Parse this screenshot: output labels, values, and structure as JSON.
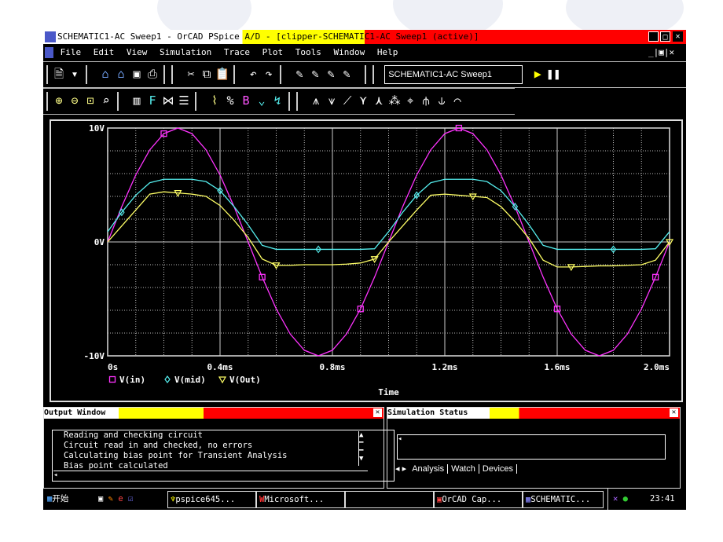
{
  "window": {
    "title_parts": [
      "SCHEMATIC1-AC Sweep1 - ",
      "OrCAD PSpice A/D",
      "  - [clipper-SCHEMAT",
      "IC1-AC Sweep1 (active)]"
    ]
  },
  "menu": [
    "File",
    "Edit",
    "View",
    "Simulation",
    "Trace",
    "Plot",
    "Tools",
    "Window",
    "Help"
  ],
  "toolbar": {
    "profile_select": "SCHEMATIC1-AC Sweep1",
    "run_icon": "play-icon",
    "pause_icon": "pause-icon"
  },
  "chart_data": {
    "type": "line",
    "xlabel": "Time",
    "x_unit": "ms",
    "xlim": [
      0,
      2.0
    ],
    "ylim": [
      -10,
      10
    ],
    "x_ticks": [
      "0s",
      "0.4ms",
      "0.8ms",
      "1.2ms",
      "1.6ms",
      "2.0ms"
    ],
    "y_ticks": [
      "10V",
      "0V",
      "-10V"
    ],
    "grid": true,
    "legend": "bottom-left",
    "x": [
      0,
      0.05,
      0.1,
      0.15,
      0.2,
      0.25,
      0.3,
      0.35,
      0.4,
      0.45,
      0.5,
      0.55,
      0.6,
      0.65,
      0.7,
      0.75,
      0.8,
      0.85,
      0.9,
      0.95,
      1.0,
      1.05,
      1.1,
      1.15,
      1.2,
      1.25,
      1.3,
      1.35,
      1.4,
      1.45,
      1.5,
      1.55,
      1.6,
      1.65,
      1.7,
      1.75,
      1.8,
      1.85,
      1.9,
      1.95,
      2.0
    ],
    "series": [
      {
        "name": "V(in)",
        "color": "#ff33ff",
        "marker": "square",
        "values": [
          0,
          3.09,
          5.88,
          8.09,
          9.51,
          10,
          9.51,
          8.09,
          5.88,
          3.09,
          0,
          -3.09,
          -5.88,
          -8.09,
          -9.51,
          -10,
          -9.51,
          -8.09,
          -5.88,
          -3.09,
          0,
          3.09,
          5.88,
          8.09,
          9.51,
          10,
          9.51,
          8.09,
          5.88,
          3.09,
          0,
          -3.09,
          -5.88,
          -8.09,
          -9.51,
          -10,
          -9.51,
          -8.09,
          -5.88,
          -3.09,
          0
        ]
      },
      {
        "name": "V(mid)",
        "color": "#55eeee",
        "marker": "diamond",
        "values": [
          0.9,
          2.6,
          4.1,
          5.2,
          5.5,
          5.5,
          5.5,
          5.3,
          4.5,
          3.1,
          1.5,
          -0.3,
          -0.65,
          -0.65,
          -0.65,
          -0.65,
          -0.65,
          -0.65,
          -0.65,
          -0.6,
          0.9,
          2.6,
          4.1,
          5.2,
          5.5,
          5.5,
          5.5,
          5.3,
          4.5,
          3.1,
          1.5,
          -0.3,
          -0.65,
          -0.65,
          -0.65,
          -0.65,
          -0.65,
          -0.65,
          -0.65,
          -0.6,
          0.9
        ]
      },
      {
        "name": "V(Out)",
        "color": "#ffff66",
        "marker": "triangle",
        "values": [
          0,
          1.4,
          2.8,
          4.2,
          4.4,
          4.3,
          4.2,
          4.0,
          3.2,
          1.9,
          0.4,
          -1.5,
          -2.05,
          -2.05,
          -2.0,
          -2.0,
          -2.0,
          -1.95,
          -1.85,
          -1.5,
          0,
          1.4,
          2.8,
          4.1,
          4.2,
          4.1,
          4.0,
          3.9,
          3.1,
          1.8,
          0.3,
          -1.6,
          -2.2,
          -2.2,
          -2.15,
          -2.1,
          -2.1,
          -2.05,
          -2.0,
          -1.6,
          0
        ]
      }
    ]
  },
  "output_window": {
    "title": "Output Window",
    "lines": [
      "Reading and checking circuit",
      "Circuit read in and checked, no errors",
      "Calculating bias point for Transient Analysis",
      "Bias point calculated"
    ]
  },
  "simulation_status": {
    "title": "Simulation Status",
    "tabs": [
      "Analysis",
      "Watch",
      "Devices"
    ]
  },
  "taskbar": {
    "start": "开始",
    "tasks": [
      "pspice645...",
      "Microsoft...",
      "",
      "OrCAD Cap...",
      "SCHEMATIC..."
    ],
    "clock": "23:41"
  }
}
